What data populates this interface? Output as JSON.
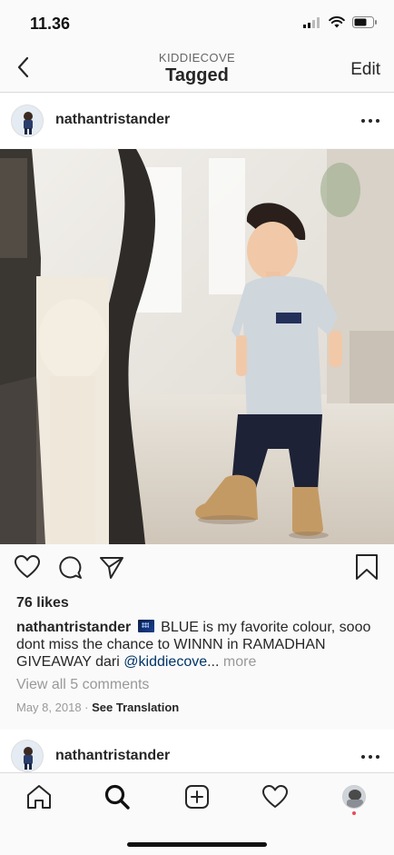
{
  "status_bar": {
    "time": "11.36"
  },
  "nav": {
    "subtitle": "KIDDIECOVE",
    "title": "Tagged",
    "edit_label": "Edit",
    "back_icon": "chevron-left-icon"
  },
  "post": {
    "username": "nathantristander",
    "likes": "76 likes",
    "caption": {
      "username": "nathantristander",
      "text": " BLUE is my favorite colour, sooo dont miss the chance to WINNN in RAMADHAN GIVEAWAY dari ",
      "mention": "@kiddiecove",
      "ellipsis": "...",
      "more": " more"
    },
    "comments_link": "View all 5 comments",
    "date": "May 8, 2018",
    "separator": " · ",
    "see_translation": "See Translation"
  },
  "next_post": {
    "username": "nathantristander"
  },
  "tab_bar": {
    "items": [
      "home-icon",
      "search-icon",
      "new-post-icon",
      "activity-heart-icon",
      "profile-avatar"
    ]
  },
  "colors": {
    "background": "#fafafa",
    "text": "#262626",
    "secondary_text": "#999999",
    "mention": "#003569",
    "notification": "#ed4956"
  }
}
